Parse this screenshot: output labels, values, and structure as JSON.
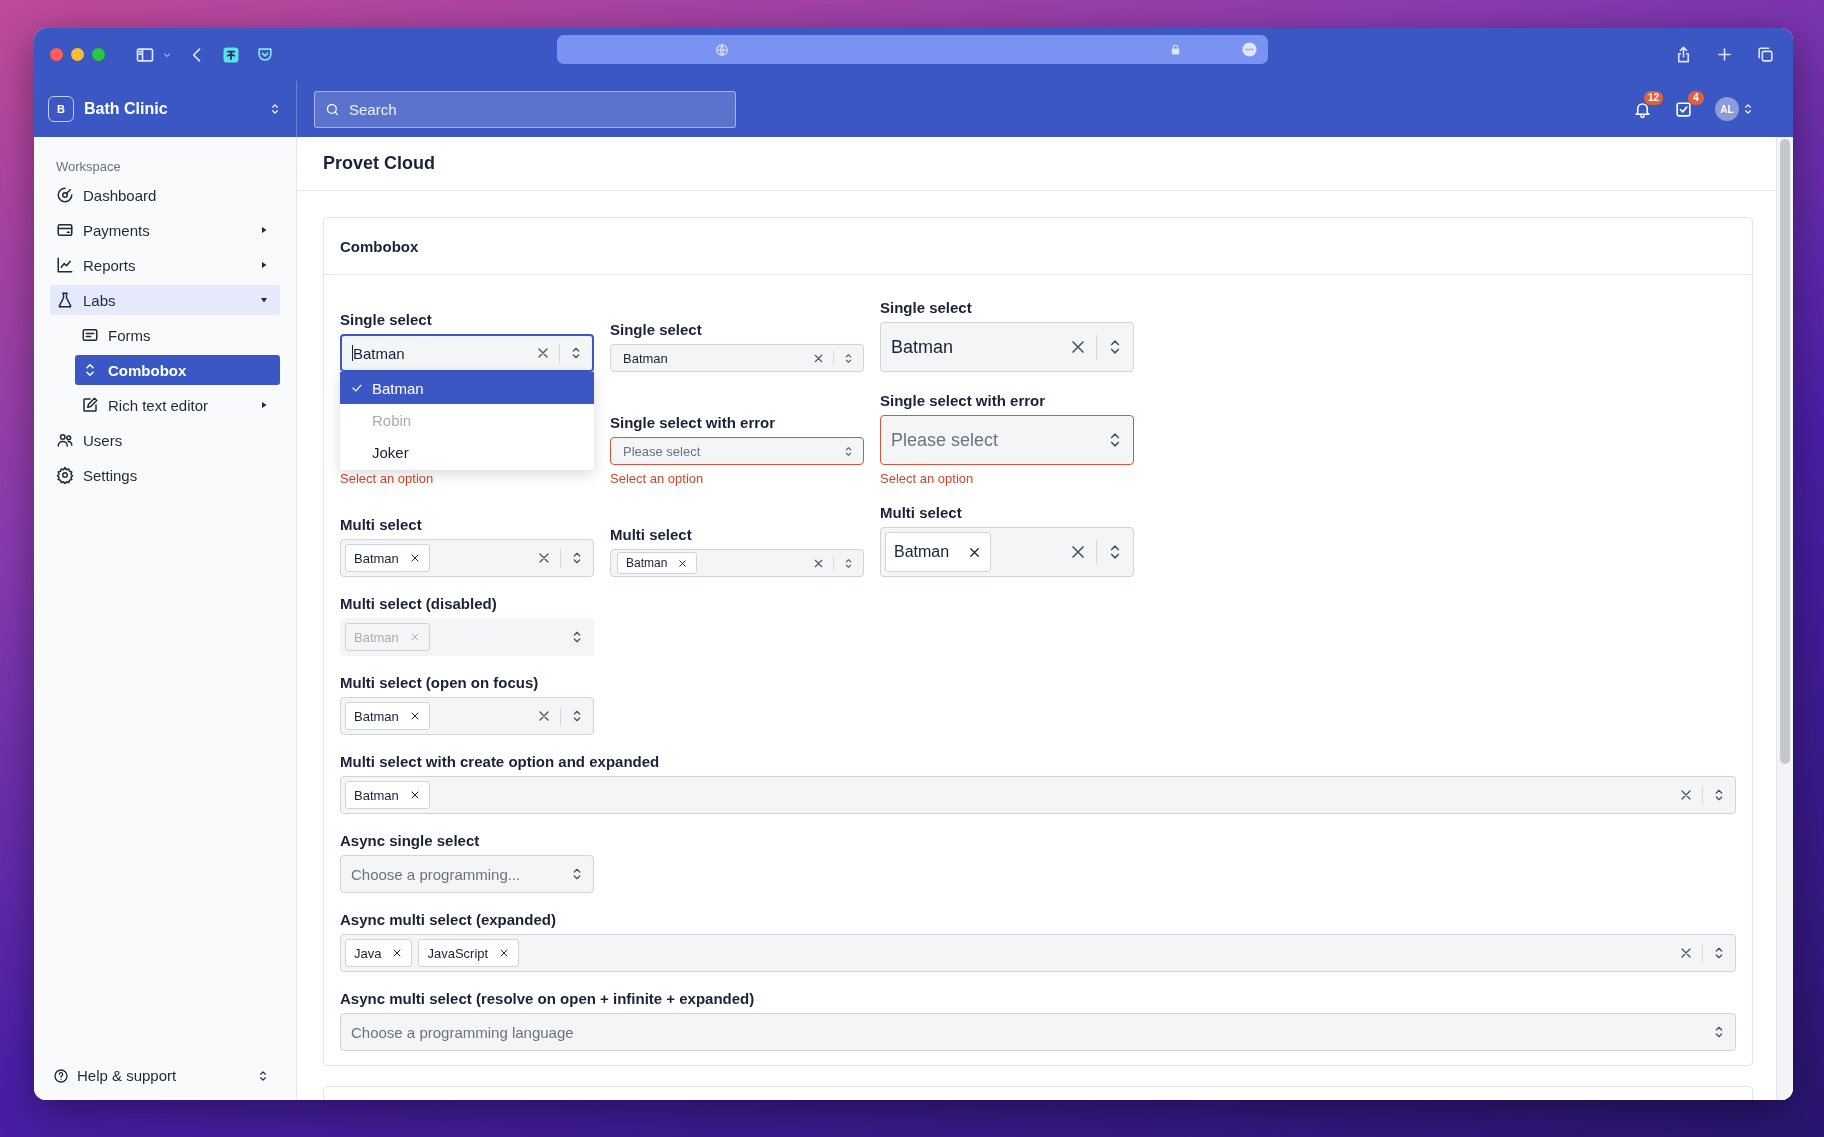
{
  "app_header": {
    "org_initial": "B",
    "org_name": "Bath Clinic",
    "search": {
      "placeholder": "Search"
    },
    "notifications_badge": "12",
    "tasks_badge": "4",
    "avatar_initials": "AL"
  },
  "sidebar": {
    "section": "Workspace",
    "items": [
      {
        "label": "Dashboard",
        "current": false,
        "selected": false
      },
      {
        "label": "Payments",
        "current": false,
        "selected": false,
        "expanded": false
      },
      {
        "label": "Reports",
        "current": false,
        "selected": false,
        "expanded": false
      },
      {
        "label": "Labs",
        "current": true,
        "selected": false,
        "expanded": true,
        "children": [
          {
            "label": "Forms",
            "selected": false
          },
          {
            "label": "Combobox",
            "selected": true
          },
          {
            "label": "Rich text editor",
            "selected": false,
            "expanded": false
          }
        ]
      },
      {
        "label": "Users",
        "current": false,
        "selected": false
      },
      {
        "label": "Settings",
        "current": false,
        "selected": false
      }
    ],
    "footer": "Help & support"
  },
  "page_title": "Provet Cloud",
  "card": {
    "title": "Combobox",
    "grid_rows": [
      [
        {
          "kind": "single",
          "label": "Single select",
          "value": "Batman",
          "clearable": true,
          "focused": true,
          "options": [
            {
              "label": "Batman",
              "selected": true,
              "disabled": false
            },
            {
              "label": "Robin",
              "selected": false,
              "disabled": true
            },
            {
              "label": "Joker",
              "selected": false,
              "disabled": false
            }
          ]
        },
        {
          "kind": "single",
          "label": "Single select",
          "value": "Batman",
          "clearable": true
        },
        {
          "kind": "single",
          "label": "Single select",
          "value": "Batman",
          "clearable": true
        }
      ],
      [
        {
          "kind": "covered",
          "error": "Select an option"
        },
        {
          "kind": "single",
          "label": "Single select with error",
          "placeholder": "Please select",
          "clearable": false,
          "error": "Select an option"
        },
        {
          "kind": "single",
          "label": "Single select with error",
          "placeholder": "Please select",
          "clearable": false,
          "error": "Select an option"
        }
      ],
      [
        {
          "kind": "multi",
          "label": "Multi select",
          "tags": [
            "Batman"
          ],
          "clearable": true
        },
        {
          "kind": "multi",
          "label": "Multi select",
          "tags": [
            "Batman"
          ],
          "clearable": true
        },
        {
          "kind": "multi",
          "label": "Multi select",
          "tags": [
            "Batman"
          ],
          "clearable": true
        }
      ]
    ],
    "fields": [
      {
        "kind": "multi",
        "label": "Multi select (disabled)",
        "tags": [
          "Batman"
        ],
        "clearable": false,
        "disabled": true,
        "wide": false
      },
      {
        "kind": "multi",
        "label": "Multi select (open on focus)",
        "tags": [
          "Batman"
        ],
        "clearable": true,
        "wide": false
      },
      {
        "kind": "multi",
        "label": "Multi select with create option and expanded",
        "tags": [
          "Batman"
        ],
        "clearable": true,
        "wide": true
      },
      {
        "kind": "single",
        "label": "Async single select",
        "placeholder": "Choose a programming...",
        "clearable": false,
        "wide": false
      },
      {
        "kind": "multi",
        "label": "Async multi select (expanded)",
        "tags": [
          "Java",
          "JavaScript"
        ],
        "clearable": true,
        "wide": true
      },
      {
        "kind": "single",
        "label": "Async multi select (resolve on open + infinite + expanded)",
        "placeholder": "Choose a programming language",
        "clearable": false,
        "wide": true
      }
    ]
  }
}
